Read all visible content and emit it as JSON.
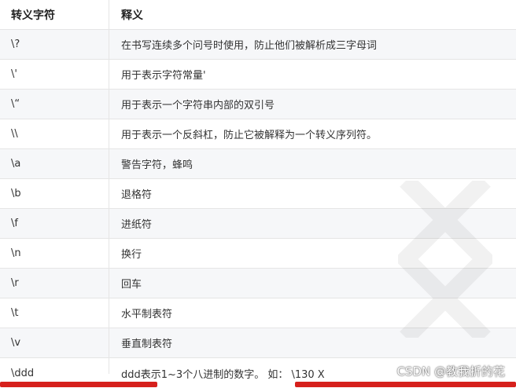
{
  "header": {
    "col1": "转义字符",
    "col2": "释义"
  },
  "rows": [
    {
      "escape": "\\?",
      "meaning": "在书写连续多个问号时使用，防止他们被解析成三字母词"
    },
    {
      "escape": "\\'",
      "meaning": "用于表示字符常量'"
    },
    {
      "escape": "\\“",
      "meaning": "用于表示一个字符串内部的双引号"
    },
    {
      "escape": "\\\\",
      "meaning": "用于表示一个反斜杠，防止它被解释为一个转义序列符。"
    },
    {
      "escape": "\\a",
      "meaning": "警告字符，蜂鸣"
    },
    {
      "escape": "\\b",
      "meaning": "退格符"
    },
    {
      "escape": "\\f",
      "meaning": "进纸符"
    },
    {
      "escape": "\\n",
      "meaning": "换行"
    },
    {
      "escape": "\\r",
      "meaning": "回车"
    },
    {
      "escape": "\\t",
      "meaning": "水平制表符"
    },
    {
      "escape": "\\v",
      "meaning": "垂直制表符"
    },
    {
      "escape": "\\ddd",
      "meaning": "ddd表示1~3个八进制的数字。 如： \\130 X"
    }
  ],
  "watermark": "CSDN @教我折的花",
  "colors": {
    "row_alt": "#f6f7f9",
    "border": "#e5e5e5",
    "subtitle_red": "#d6201c"
  }
}
